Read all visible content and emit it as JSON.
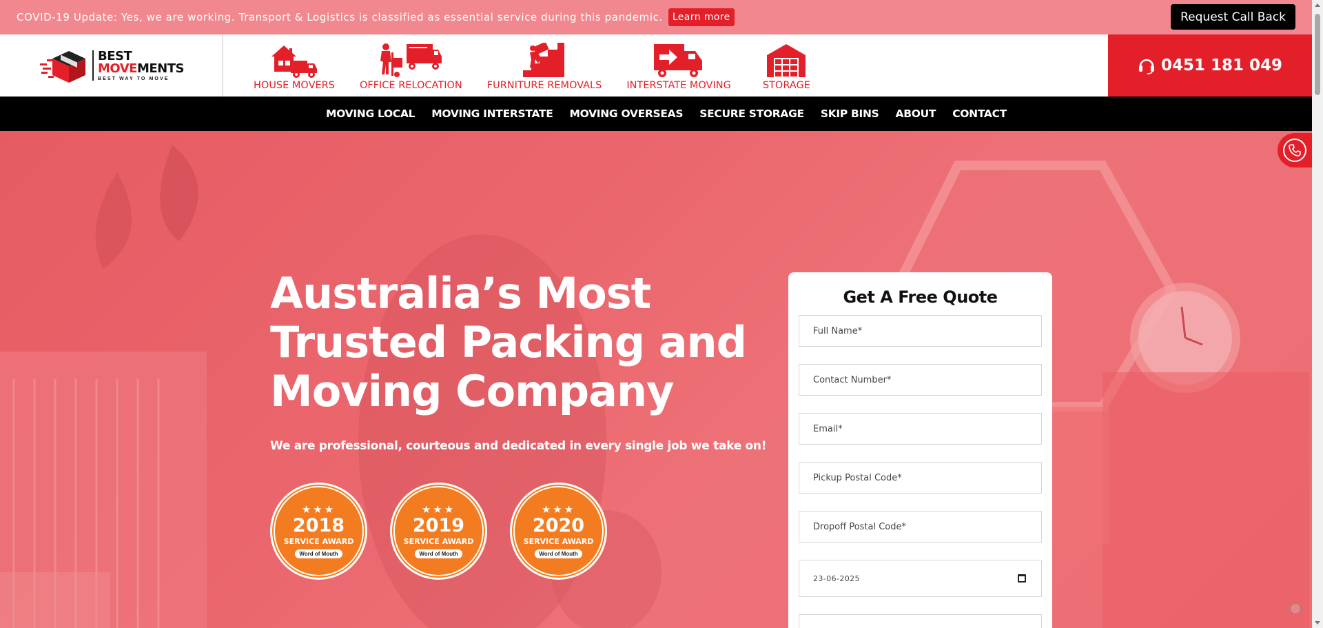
{
  "topbar": {
    "covid_text": "COVID-19 Update: Yes, we are working. Transport & Logistics is classified as essential service during this pandemic.",
    "learn_more": "Learn more",
    "callback": "Request Call Back"
  },
  "logo": {
    "line1": "BEST",
    "line2_red": "MOVE",
    "line2_black": "MENTS",
    "tagline": "BEST WAY TO MOVE"
  },
  "services": [
    {
      "label": "HOUSE MOVERS",
      "icon": "house-truck-icon"
    },
    {
      "label": "OFFICE RELOCATION",
      "icon": "mover-trolley-truck-icon"
    },
    {
      "label": "FURNITURE REMOVALS",
      "icon": "mover-stairs-icon"
    },
    {
      "label": "INTERSTATE MOVING",
      "icon": "arrow-truck-icon"
    },
    {
      "label": "STORAGE",
      "icon": "warehouse-icon"
    }
  ],
  "phone": "0451 181 049",
  "nav": [
    "MOVING LOCAL",
    "MOVING INTERSTATE",
    "MOVING OVERSEAS",
    "SECURE STORAGE",
    "SKIP BINS",
    "ABOUT",
    "CONTACT"
  ],
  "hero": {
    "title": "Australia’s Most Trusted Packing and Moving Company",
    "subtitle": "We are professional, courteous and dedicated in every single job we take on!"
  },
  "badges": [
    {
      "year": "2018",
      "label": "SERVICE AWARD",
      "brand": "Word of Mouth"
    },
    {
      "year": "2019",
      "label": "SERVICE AWARD",
      "brand": "Word of Mouth"
    },
    {
      "year": "2020",
      "label": "SERVICE AWARD",
      "brand": "Word of Mouth"
    }
  ],
  "quote": {
    "title": "Get A Free Quote",
    "full_name": "Full Name*",
    "contact": "Contact Number*",
    "email": "Email*",
    "pickup": "Pickup Postal Code*",
    "dropoff": "Dropoff Postal Code*",
    "date": "23-06-2025"
  },
  "colors": {
    "brand_red": "#e3202a",
    "banner_pink": "#f1888f",
    "badge_orange": "#f47c20"
  }
}
